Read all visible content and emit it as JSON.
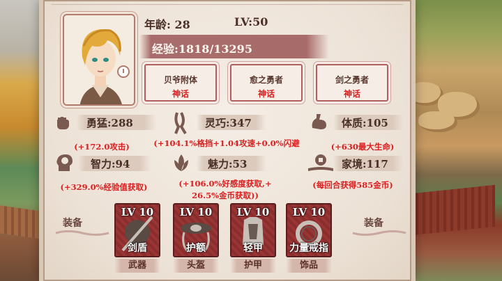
{
  "character": {
    "age_text": "年龄: 28",
    "level_text": "LV:50",
    "exp_text": "经验:1818/13295",
    "portrait_icon": "hero-portrait"
  },
  "talents": [
    {
      "name": "贝爷附体",
      "rarity": "神话"
    },
    {
      "name": "愈之勇者",
      "rarity": "神话"
    },
    {
      "name": "剑之勇者",
      "rarity": "神话"
    }
  ],
  "stats": {
    "bravery": {
      "label": "勇猛:288",
      "bonus": "(+172.0攻击)",
      "icon": "fist-icon"
    },
    "agility": {
      "label": "灵巧:347",
      "bonus": "(+104.1%格挡+1.04攻速+0.0%闪避",
      "icon": "ribbon-icon"
    },
    "physique": {
      "label": "体质:105",
      "bonus": "(+630最大生命)",
      "icon": "flexed-arm-icon"
    },
    "intellect": {
      "label": "智力:94",
      "bonus": "(+329.0%经验值获取)",
      "icon": "brain-head-icon"
    },
    "charm": {
      "label": "魅力:53",
      "bonus_line1": "(+106.0%好感度获取,+",
      "bonus_line2": "26.5%金币获取))",
      "icon": "lotus-icon"
    },
    "wealth": {
      "label": "家境:117",
      "bonus": "(每回合获得585金币)",
      "icon": "coin-icon"
    }
  },
  "equipment": {
    "side_label_left": "装备",
    "side_label_right": "装备",
    "items": [
      {
        "level": "LV 10",
        "name": "剑盾",
        "slot": "武器",
        "icon": "sword-shield-icon"
      },
      {
        "level": "LV 10",
        "name": "护额",
        "slot": "头盔",
        "icon": "headband-icon"
      },
      {
        "level": "LV 10",
        "name": "轻甲",
        "slot": "护甲",
        "icon": "light-armor-icon"
      },
      {
        "level": "LV 10",
        "name": "力量戒指",
        "slot": "饰品",
        "icon": "ring-icon"
      }
    ]
  },
  "colors": {
    "rarity": "#d61f1f",
    "bonus": "#d82020",
    "card": "#8a2d2d",
    "parchment": "#efe6dc"
  }
}
